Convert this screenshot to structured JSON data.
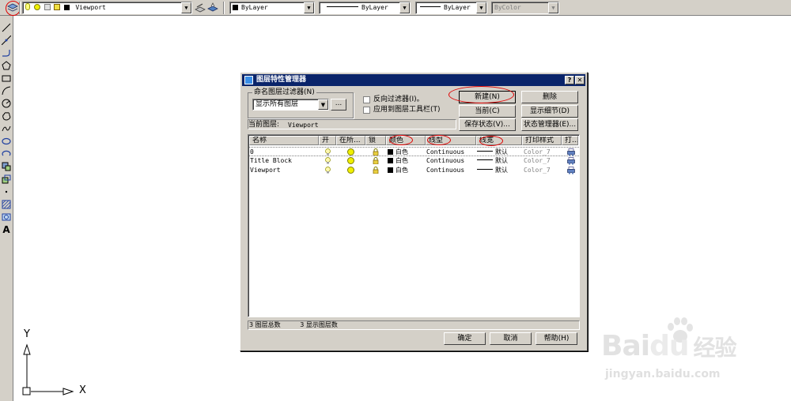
{
  "toolbar": {
    "layer_combo": "Viewport",
    "color_combo": "ByLayer",
    "linetype_combo": "ByLayer",
    "lineweight_combo": "ByLayer",
    "plotstyle_combo": "ByColor",
    "layer_manager_icon": "layers-icon",
    "make_current_icon": "make-object-layer-current-icon",
    "layer_previous_icon": "layer-previous-icon"
  },
  "draw_tools": [
    "line-icon",
    "construction-line-icon",
    "polyline-icon",
    "polygon-icon",
    "rectangle-icon",
    "arc-icon",
    "circle-icon",
    "revision-cloud-icon",
    "spline-icon",
    "ellipse-icon",
    "ellipse-arc-icon",
    "insert-block-icon",
    "make-block-icon",
    "point-icon",
    "hatch-icon",
    "region-icon",
    "multiline-text-icon"
  ],
  "ucs": {
    "y_label": "Y",
    "x_label": "X"
  },
  "dialog": {
    "title": "图层特性管理器",
    "help_btn": "?",
    "close_btn": "✕",
    "filter_group_label": "命名图层过滤器(N)",
    "filter_value": "显示所有图层",
    "filter_browse": "...",
    "invert_filter": "反向过滤器(I)。",
    "apply_toolbar": "应用到图层工具栏(T)",
    "new_btn": "新建(N)",
    "delete_btn": "删除",
    "current_btn": "当前(C)",
    "show_details_btn": "显示细节(D)",
    "current_layer_label": "当前图层:",
    "current_layer_value": "Viewport",
    "save_state_btn": "保存状态(V)...",
    "state_manager_btn": "状态管理器(E)...",
    "columns": [
      "名称",
      "开",
      "在所...",
      "锁",
      "颜色",
      "线型",
      "线宽",
      "打印样式",
      "打..."
    ],
    "layers": [
      {
        "name": "0",
        "color": "白色",
        "linetype": "Continuous",
        "lineweight": "默认",
        "plotstyle": "Color_7"
      },
      {
        "name": "Title Block",
        "color": "白色",
        "linetype": "Continuous",
        "lineweight": "默认",
        "plotstyle": "Color_7"
      },
      {
        "name": "Viewport",
        "color": "白色",
        "linetype": "Continuous",
        "lineweight": "默认",
        "plotstyle": "Color_7"
      }
    ],
    "status_total": "3 图层总数",
    "status_shown": "3 显示图层数",
    "ok_btn": "确定",
    "cancel_btn": "取消",
    "help_bottom_btn": "帮助(H)"
  },
  "watermark": {
    "brand_left": "Bai",
    "brand_right": "du",
    "brand_cn": "经验",
    "url": "jingyan.baidu.com"
  },
  "colors": {
    "title_bar": "#0a246a",
    "face": "#d4d0c8",
    "highlight_ring": "#e00000"
  }
}
